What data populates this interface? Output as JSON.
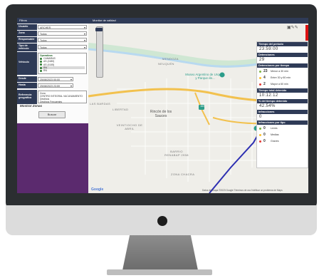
{
  "filters": {
    "header": "Filtros",
    "fields": [
      {
        "label": "Usuario",
        "value": "ARCHER"
      },
      {
        "label": "Zona",
        "value": "Todos"
      },
      {
        "label": "Responsable",
        "value": "Todos"
      },
      {
        "label": "Tipo de vehículo",
        "value": "Todos"
      }
    ],
    "vehicles_label": "Vehículo",
    "vehicles_group": "Operativos",
    "vehicles": [
      "CAMARAS",
      "AS (4180)",
      "AS (4145)",
      "RN",
      "RN",
      "RN"
    ],
    "desde_label": "Desde",
    "desde_value": "25/08/2023 00:00",
    "hasta_label": "Hasta",
    "hasta_value": "25/08/2023 23:59",
    "ref_label": "Referencia geográfica",
    "ref_items": [
      "Zona",
      "CENTRO INTEGRAL VACUNAMIENTO",
      "Destinos",
      "Destinos Frecuentes"
    ],
    "show_zones": "Mostrar Zonas",
    "search_button": "Buscar"
  },
  "map": {
    "title": "Monitor de calidad",
    "labels": {
      "mendoza": "MENDOZA",
      "neuquen": "NEUQUÉN",
      "las_bardas": "LAS BARDAS",
      "libertad": "LIBERTAD",
      "villa": "VEINTIOCHO DE ABRIL",
      "barrio": "BARRIO RENABAP 2958",
      "zona_chacra": "ZONA CHACRA"
    },
    "poi_museo": "Museo Argentino de Urquiza y Parque de...",
    "poi_cultural": "Cultural Patrimonial",
    "town": "Rincón de los Sauces",
    "route_badge": "151",
    "google": "Google",
    "attribution": "Datos del mapa ©2023 Google   Términos de uso   Notificar un problema de Maps"
  },
  "stats": {
    "period_title": "Tiempo del período",
    "period_value": "23:59:00",
    "detentions_title": "Detenciones",
    "detentions_value": "29",
    "by_time_title": "Detenciones por tiempo",
    "by_time": [
      {
        "count": "23",
        "label": "Menor a 30 min",
        "color": "#7cb342"
      },
      {
        "count": "4",
        "label": "Entre 30 y 60 min",
        "color": "#fbc02d"
      },
      {
        "count": "2",
        "label": "Mayor a 60 min",
        "color": "#e53935"
      }
    ],
    "total_title": "Tiempo total detenido",
    "total_value": "10:12:12",
    "pct_title": "% del tiempo detenido",
    "pct_value": "42.54%",
    "infractions_title": "Infracciones",
    "infractions_value": "0",
    "by_type_title": "Infracciones por tipo",
    "by_type": [
      {
        "count": "0",
        "label": "Leves",
        "color": "#7cb342"
      },
      {
        "count": "0",
        "label": "Medias",
        "color": "#fbc02d"
      },
      {
        "count": "0",
        "label": "Graves",
        "color": "#e53935"
      }
    ]
  }
}
